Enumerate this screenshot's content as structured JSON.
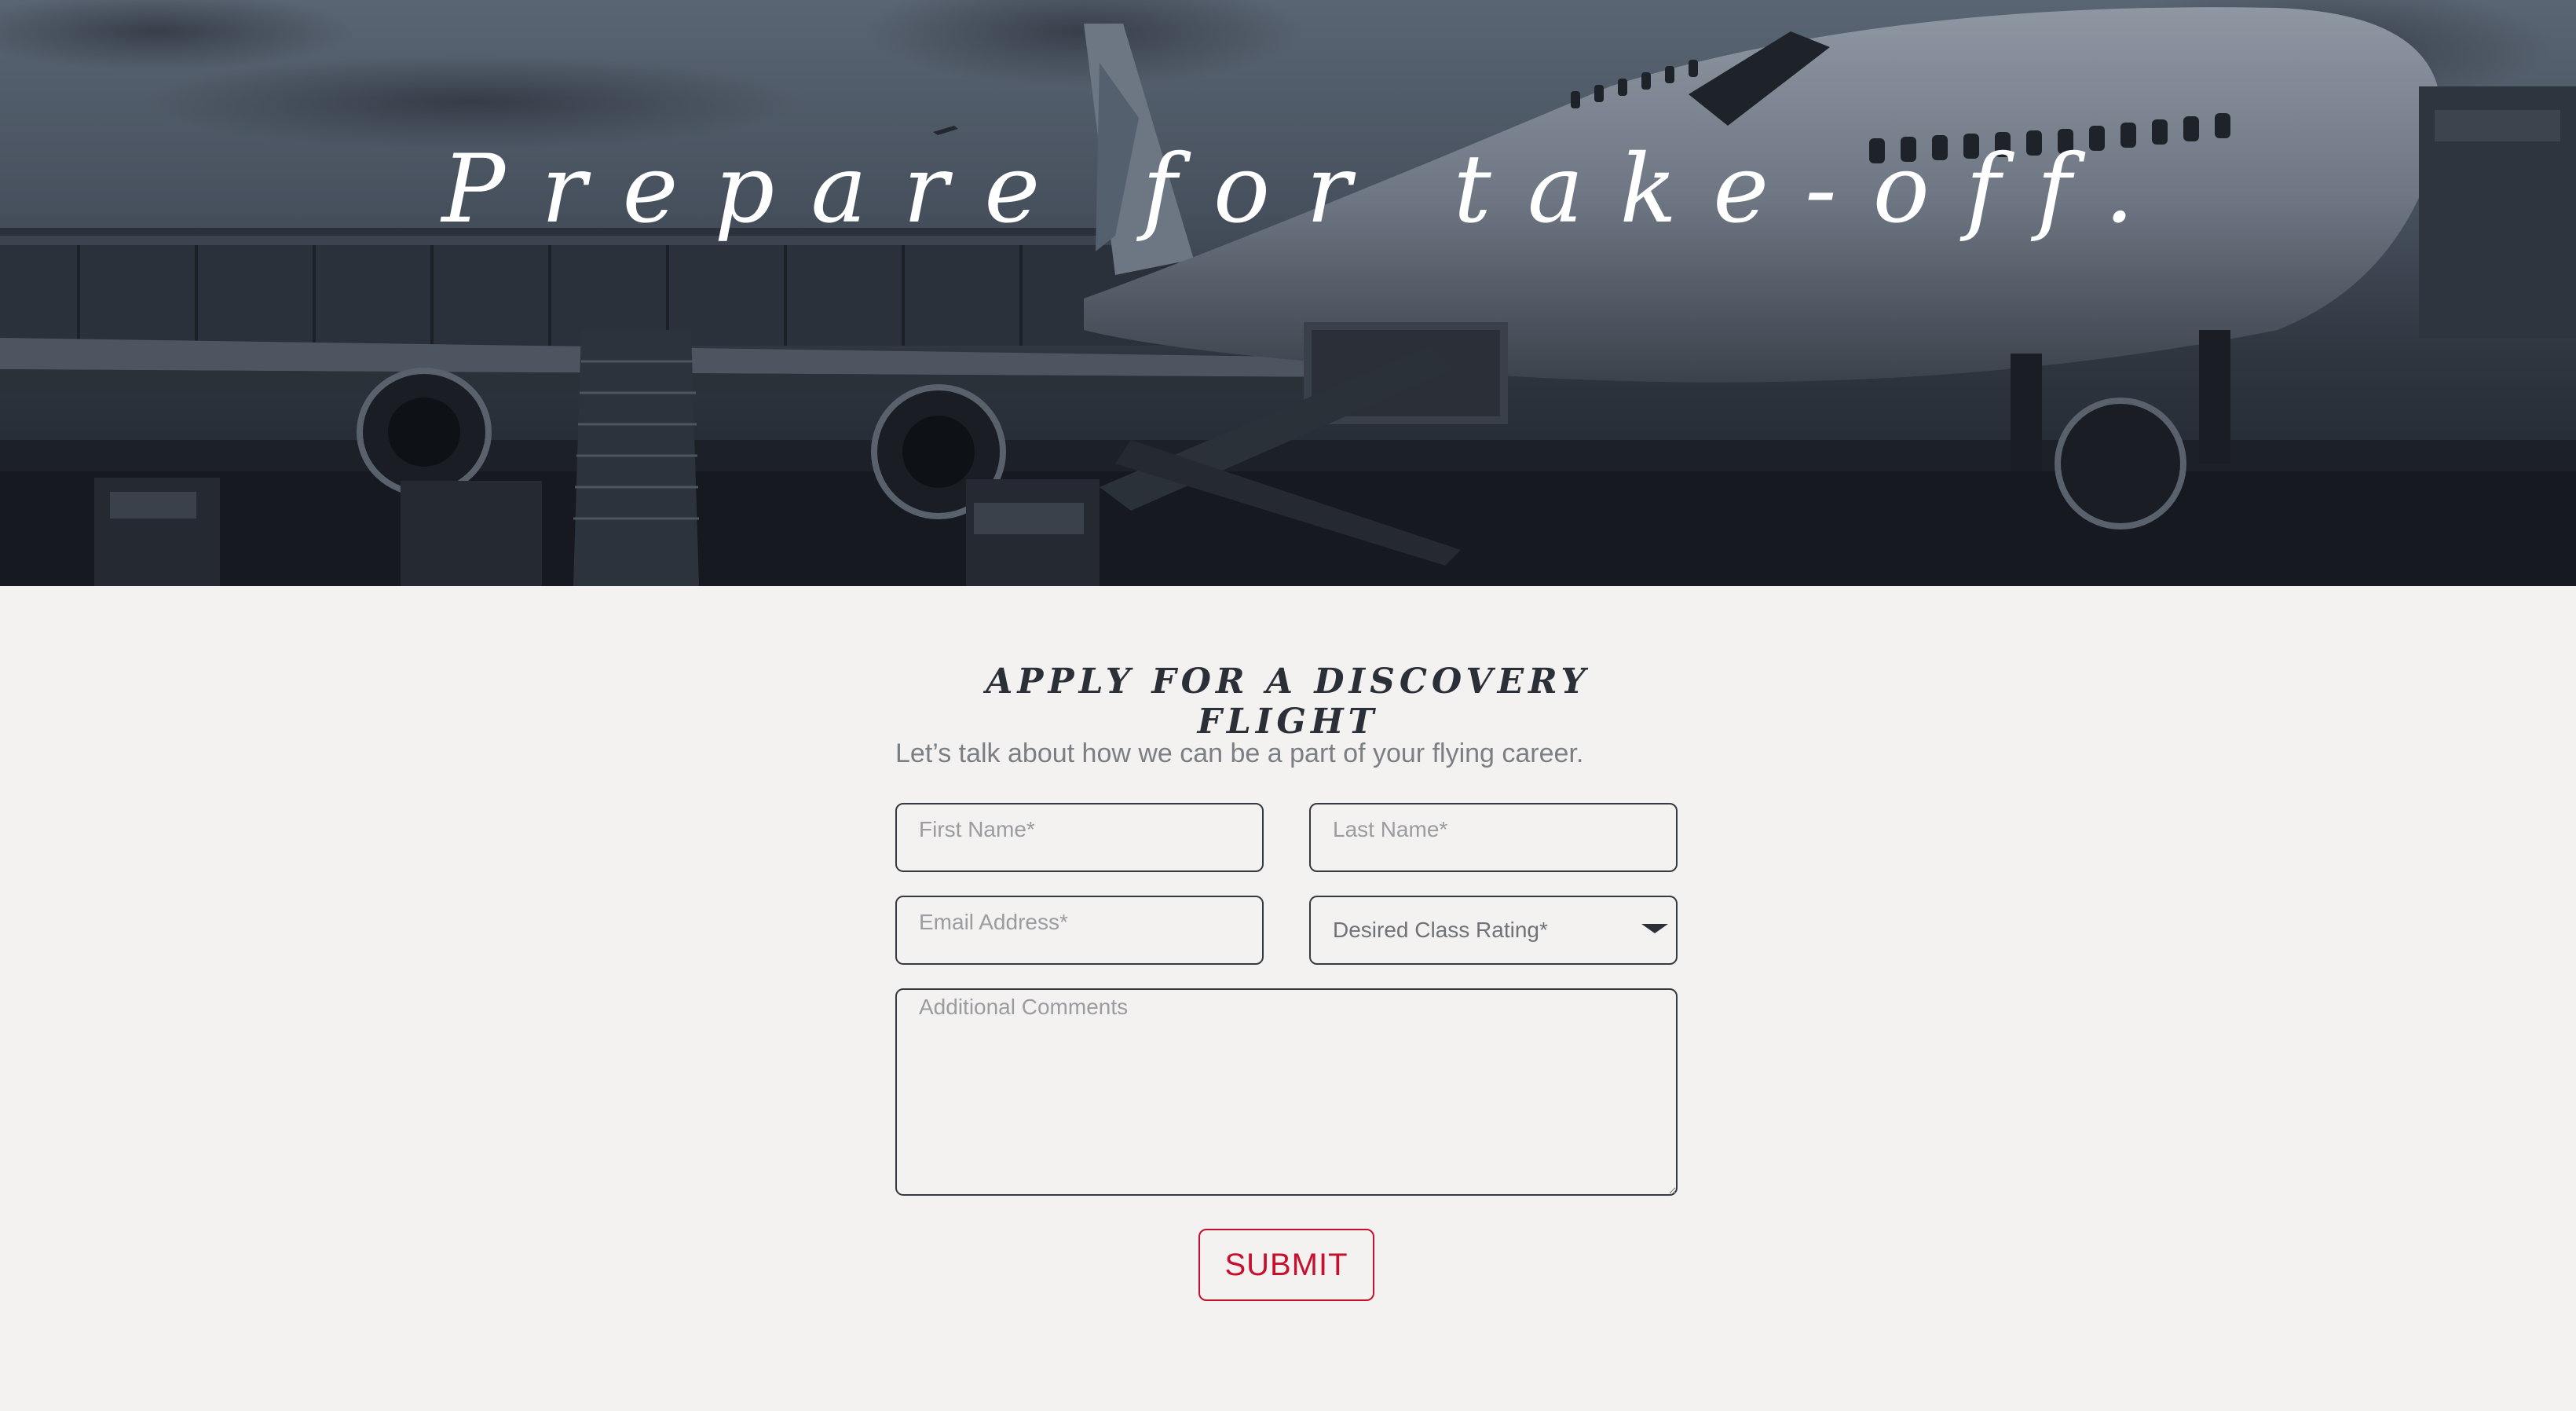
{
  "hero": {
    "title": "Prepare for take-off."
  },
  "form": {
    "heading": "APPLY FOR A DISCOVERY FLIGHT",
    "intro": "Let’s talk about how we can be a part of your flying career.",
    "first_name_placeholder": "First Name*",
    "last_name_placeholder": "Last Name*",
    "email_placeholder": "Email Address*",
    "class_rating_selected": "Desired Class Rating*",
    "comments_placeholder": "Additional Comments",
    "submit_label": "SUBMIT"
  },
  "colors": {
    "accent": "#c8102e",
    "heading": "#2b3038",
    "background": "#f3f2f1",
    "field_border": "#353a41"
  },
  "icons": {
    "select_caret": "chevron-down-icon"
  }
}
